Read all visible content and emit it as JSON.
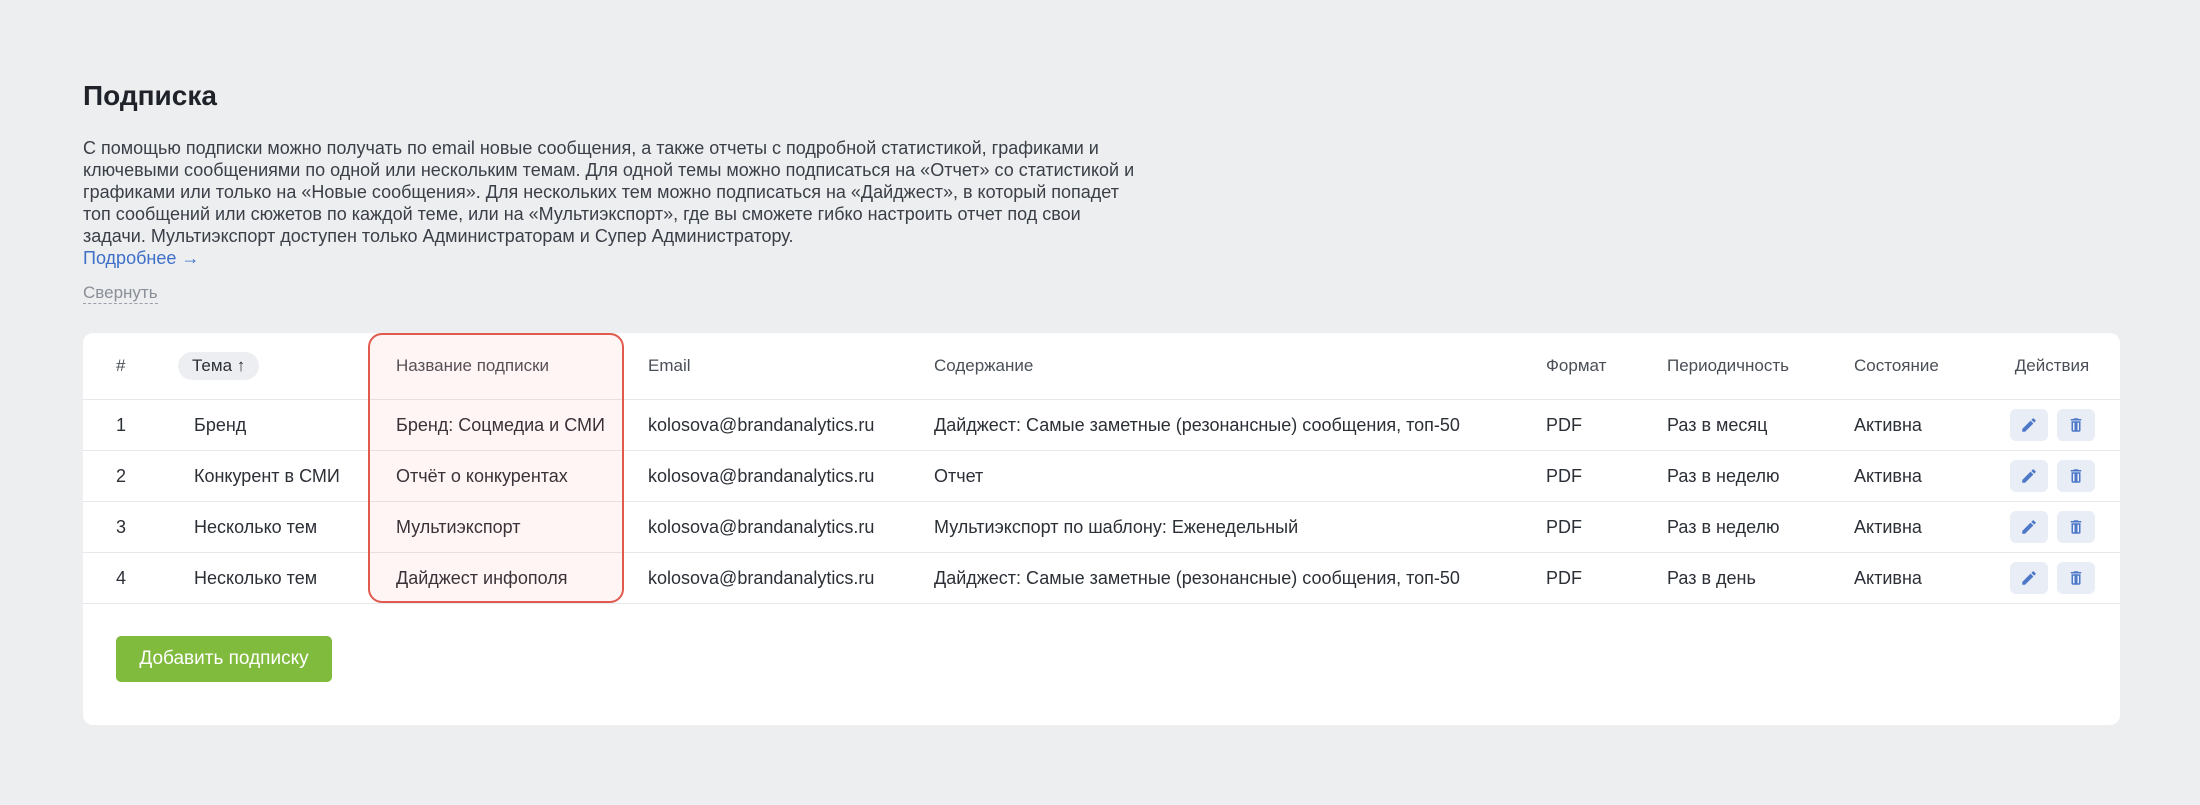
{
  "page": {
    "title": "Подписка",
    "description": "С помощью подписки можно получать по email новые сообщения, а также отчеты с подробной статистикой, графиками и ключевыми сообщениями по одной или нескольким темам. Для одной темы можно подписаться на «Отчет» со статистикой и графиками или только на «Новые сообщения». Для нескольких тем можно подписаться на «Дайджест», в который попадет топ сообщений или сюжетов по каждой теме, или на «Мультиэкспорт», где вы сможете гибко настроить отчет под свои задачи. Мультиэкспорт доступен только Администраторам и Супер Администратору.",
    "more_link": "Подробнее →",
    "collapse": "Свернуть"
  },
  "table": {
    "headers": {
      "num": "#",
      "theme": "Тема ↑",
      "name": "Название подписки",
      "email": "Email",
      "content": "Содержание",
      "format": "Формат",
      "period": "Периодичность",
      "state": "Состояние",
      "actions": "Действия"
    },
    "rows": [
      {
        "num": "1",
        "theme": "Бренд",
        "name": "Бренд: Соцмедиа и СМИ",
        "email": "kolosova@brandanalytics.ru",
        "content": "Дайджест: Самые заметные (резонансные) сообщения, топ-50",
        "format": "PDF",
        "period": "Раз в месяц",
        "state": "Активна"
      },
      {
        "num": "2",
        "theme": "Конкурент в СМИ",
        "name": "Отчёт о конкурентах",
        "email": "kolosova@brandanalytics.ru",
        "content": "Отчет",
        "format": "PDF",
        "period": "Раз в неделю",
        "state": "Активна"
      },
      {
        "num": "3",
        "theme": "Несколько тем",
        "name": "Мультиэкспорт",
        "email": "kolosova@brandanalytics.ru",
        "content": "Мультиэкспорт по шаблону: Еженедельный",
        "format": "PDF",
        "period": "Раз в неделю",
        "state": "Активна"
      },
      {
        "num": "4",
        "theme": "Несколько тем",
        "name": "Дайджест инфополя",
        "email": "kolosova@brandanalytics.ru",
        "content": "Дайджест: Самые заметные (резонансные) сообщения, топ-50",
        "format": "PDF",
        "period": "Раз в день",
        "state": "Активна"
      }
    ]
  },
  "add_button": "Добавить подписку",
  "icons": {
    "edit": "pencil-icon",
    "delete": "trash-icon"
  },
  "colors": {
    "accent_green": "#80bb3e",
    "link_blue": "#3d6fc9",
    "highlight_red": "#e05a4e",
    "icon_blue": "#4d78c8"
  }
}
